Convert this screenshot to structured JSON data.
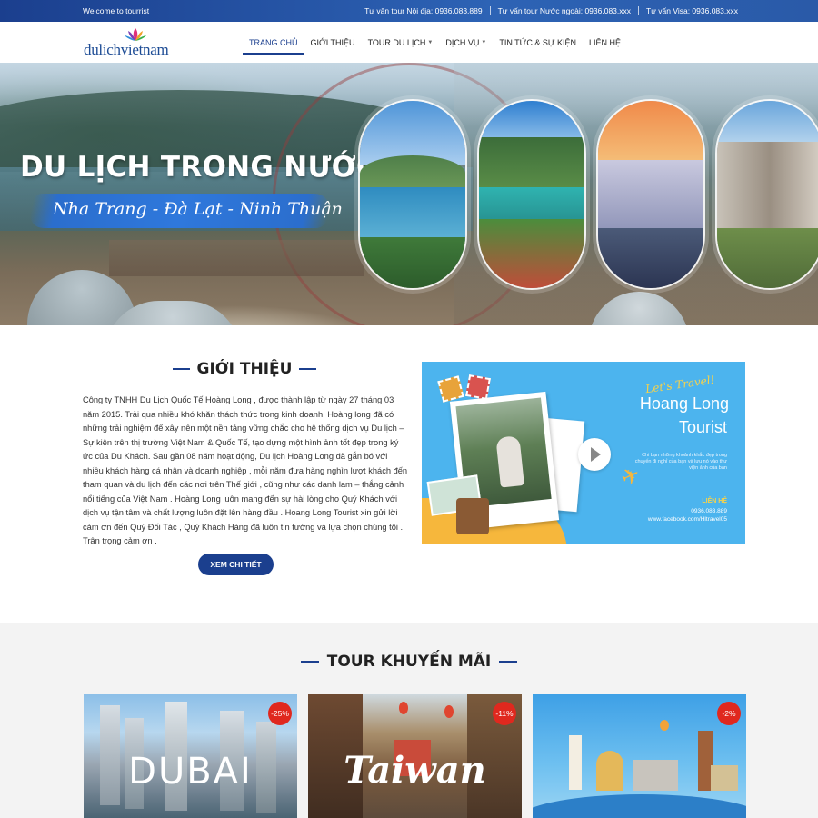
{
  "topbar": {
    "welcome": "Welcome to tourrist",
    "contacts": [
      "Tư vấn tour Nội địa: 0936.083.889",
      "Tư vấn tour Nước ngoài: 0936.083.xxx",
      "Tư vấn Visa: 0936.083.xxx"
    ]
  },
  "header": {
    "logo": {
      "text_a": "dulich",
      "text_b": "vietnam",
      "icon": "lotus-logo-icon"
    },
    "nav": [
      {
        "label": "TRANG CHỦ",
        "active": true
      },
      {
        "label": "GIỚI THIỆU"
      },
      {
        "label": "TOUR DU LỊCH",
        "dropdown": true
      },
      {
        "label": "DỊCH VỤ",
        "dropdown": true
      },
      {
        "label": "TIN TỨC & SỰ KIỆN"
      },
      {
        "label": "LIÊN HỆ"
      }
    ]
  },
  "hero": {
    "title": "DU LỊCH TRONG NƯỚC",
    "subtitle": "Nha Trang - Đà Lạt - Ninh Thuận",
    "slides": 3,
    "active_slide": 1
  },
  "intro": {
    "title": "GIỚI THIỆU",
    "text": "Công ty TNHH Du Lịch Quốc Tế Hoàng Long , được thành lập từ ngày 27 tháng 03 năm 2015. Trải qua nhiều khó khăn thách thức trong kinh doanh, Hoàng long đã có những trải nghiệm để xây nên một nền tảng vững chắc cho hệ thống dịch vụ Du lịch – Sự kiện trên thị trường Việt Nam & Quốc Tế, tạo dựng một hình ảnh tốt đẹp trong ký ức của Du Khách. Sau gần 08 năm hoạt động, Du lịch Hoàng Long đã gắn bó với nhiều khách hàng cá nhân và doanh nghiệp , mỗi năm đưa hàng nghìn lượt khách đến tham quan và du lịch đến các nơi trên Thế giới , cũng như các danh lam – thắng cảnh nổi tiếng của Việt Nam . Hoàng Long luôn mang đến sự hài lòng cho Quý Khách với dịch vụ tận tâm và chất lượng luôn đặt lên hàng đầu . Hoang Long Tourist xin gửi lời cảm ơn đến Quý Đối Tác , Quý Khách Hàng đã luôn tin tưởng và lựa chọn chúng tôi . Trân trọng cảm ơn .",
    "button": "XEM CHI TIẾT",
    "promo": {
      "lets": "Let's Travel!",
      "brand_line1": "Hoang Long",
      "brand_line2": "Tourist",
      "small": "Chi bạn những khoảnh khắc đẹp trong chuyến đi nghỉ của bạn và lưu nó vào thư viện ảnh của bạn",
      "contact_heading": "LIÊN HỆ",
      "contact_phone": "0936.083.889",
      "contact_facebook": "www.facebook.com/Hltravel05"
    }
  },
  "tours": {
    "title": "TOUR KHUYẾN MÃI",
    "items": [
      {
        "name": "DUBAI",
        "badge": "-25%"
      },
      {
        "name": "Taiwan",
        "badge": "-11%"
      },
      {
        "name": "",
        "badge": "-2%"
      }
    ]
  }
}
